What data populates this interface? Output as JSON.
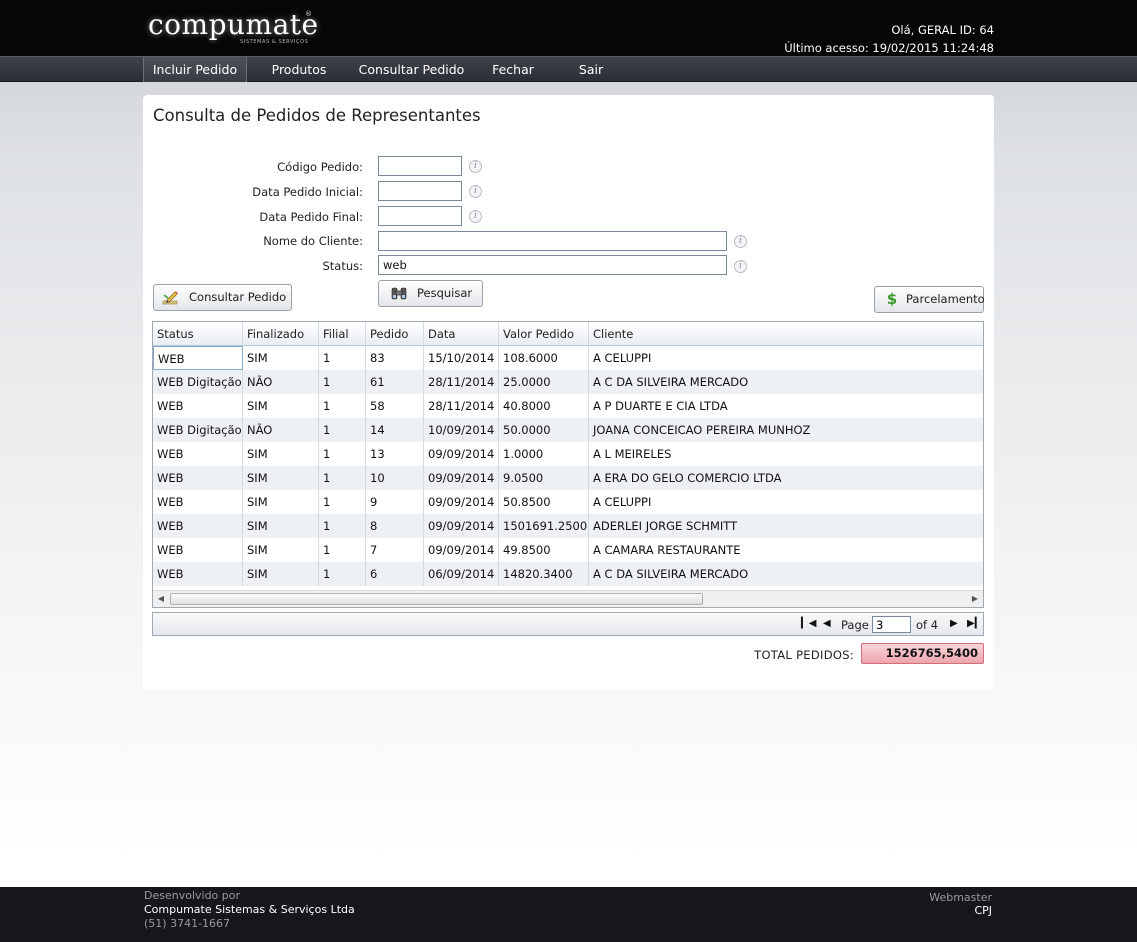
{
  "header": {
    "logo": "compumate",
    "logo_reg": "®",
    "logo_sub": "SISTEMAS & SERVIÇOS",
    "greeting": "Olá, GERAL ID: 64",
    "last_access": "Último acesso: 19/02/2015 11:24:48"
  },
  "nav": {
    "items": [
      "Incluir Pedido",
      "Produtos",
      "Consultar Pedido",
      "Fechar",
      "Sair"
    ],
    "active": "Incluir Pedido"
  },
  "page": {
    "title": "Consulta de Pedidos de Representantes"
  },
  "form": {
    "codigo_label": "Código Pedido:",
    "codigo_value": "",
    "data_ini_label": "Data Pedido Inicial:",
    "data_ini_value": "",
    "data_fim_label": "Data Pedido Final:",
    "data_fim_value": "",
    "cliente_label": "Nome do Cliente:",
    "cliente_value": "",
    "status_label": "Status:",
    "status_value": "web",
    "info_glyph": "i"
  },
  "buttons": {
    "consultar": "Consultar Pedido",
    "pesquisar": "Pesquisar",
    "parcelamento": "Parcelamento",
    "parcelamento_icon": "$"
  },
  "grid": {
    "columns": [
      "Status",
      "Finalizado",
      "Filial",
      "Pedido",
      "Data",
      "Valor Pedido",
      "Cliente"
    ],
    "rows": [
      [
        "WEB",
        "SIM",
        "1",
        "83",
        "15/10/2014",
        "108.6000",
        "A CELUPPI"
      ],
      [
        "WEB Digitação",
        "NÃO",
        "1",
        "61",
        "28/11/2014",
        "25.0000",
        "A C DA SILVEIRA MERCADO"
      ],
      [
        "WEB",
        "SIM",
        "1",
        "58",
        "28/11/2014",
        "40.8000",
        "A P DUARTE E CIA LTDA"
      ],
      [
        "WEB Digitação",
        "NÃO",
        "1",
        "14",
        "10/09/2014",
        "50.0000",
        "JOANA CONCEICAO PEREIRA MUNHOZ"
      ],
      [
        "WEB",
        "SIM",
        "1",
        "13",
        "09/09/2014",
        "1.0000",
        "A L MEIRELES"
      ],
      [
        "WEB",
        "SIM",
        "1",
        "10",
        "09/09/2014",
        "9.0500",
        "A ERA DO GELO COMERCIO LTDA"
      ],
      [
        "WEB",
        "SIM",
        "1",
        "9",
        "09/09/2014",
        "50.8500",
        "A CELUPPI"
      ],
      [
        "WEB",
        "SIM",
        "1",
        "8",
        "09/09/2014",
        "1501691.2500",
        "ADERLEI JORGE SCHMITT"
      ],
      [
        "WEB",
        "SIM",
        "1",
        "7",
        "09/09/2014",
        "49.8500",
        "A CAMARA RESTAURANTE"
      ],
      [
        "WEB",
        "SIM",
        "1",
        "6",
        "06/09/2014",
        "14820.3400",
        "A C DA SILVEIRA MERCADO"
      ]
    ]
  },
  "pager": {
    "page_label": "Page",
    "current_page": "3",
    "of_label": "of 4"
  },
  "total": {
    "label": "TOTAL PEDIDOS:",
    "value": "1526765,5400"
  },
  "footer": {
    "dev_label": "Desenvolvido por",
    "company": "Compumate Sistemas & Serviços Ltda",
    "phone": "(51) 3741-1667",
    "webmaster_label": "Webmaster",
    "webmaster_value": "CPJ"
  },
  "colors": {
    "header_bg": "#060606",
    "nav_bg": "#2b2f35",
    "footer_bg": "#17171b",
    "total_bg": "#eda5ad",
    "grid_alt_row": "#eef1f4"
  }
}
